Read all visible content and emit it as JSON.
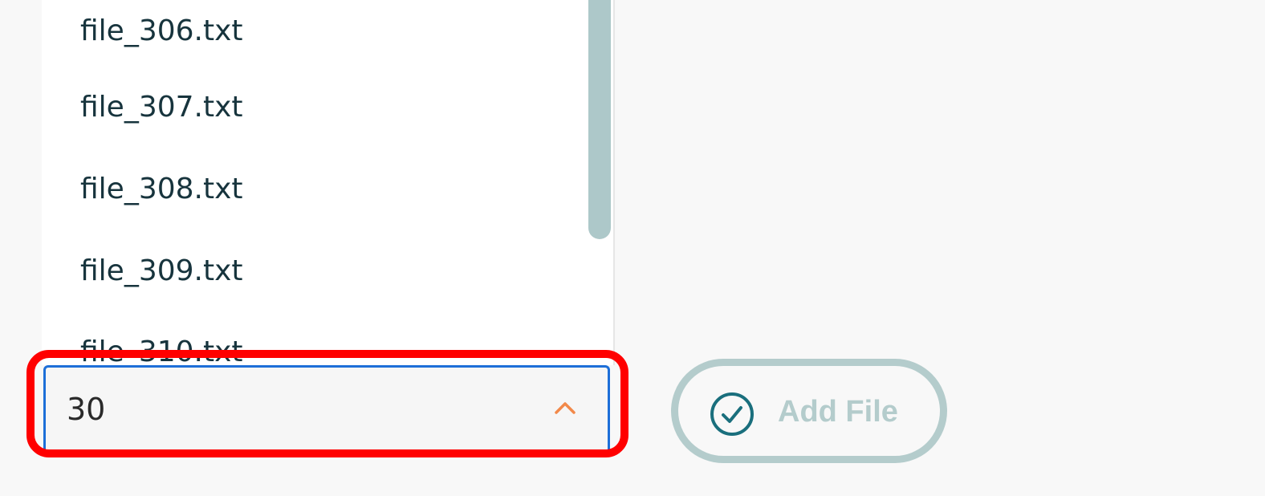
{
  "dropdown": {
    "options": [
      {
        "label": "file_306.txt"
      },
      {
        "label": "file_307.txt"
      },
      {
        "label": "file_308.txt"
      },
      {
        "label": "file_309.txt"
      },
      {
        "label": "file_310.txt"
      }
    ],
    "selected_value": "30",
    "chevron_icon": "chevron-up-icon",
    "chevron_color": "#f2894a",
    "focus_border_color": "#1d6fd8"
  },
  "add_file_button": {
    "label": "Add File",
    "icon": "check-circle-icon",
    "icon_color": "#1a6f7d",
    "disabled_color": "#b4cccc"
  },
  "highlight": {
    "color": "#ff0000"
  }
}
